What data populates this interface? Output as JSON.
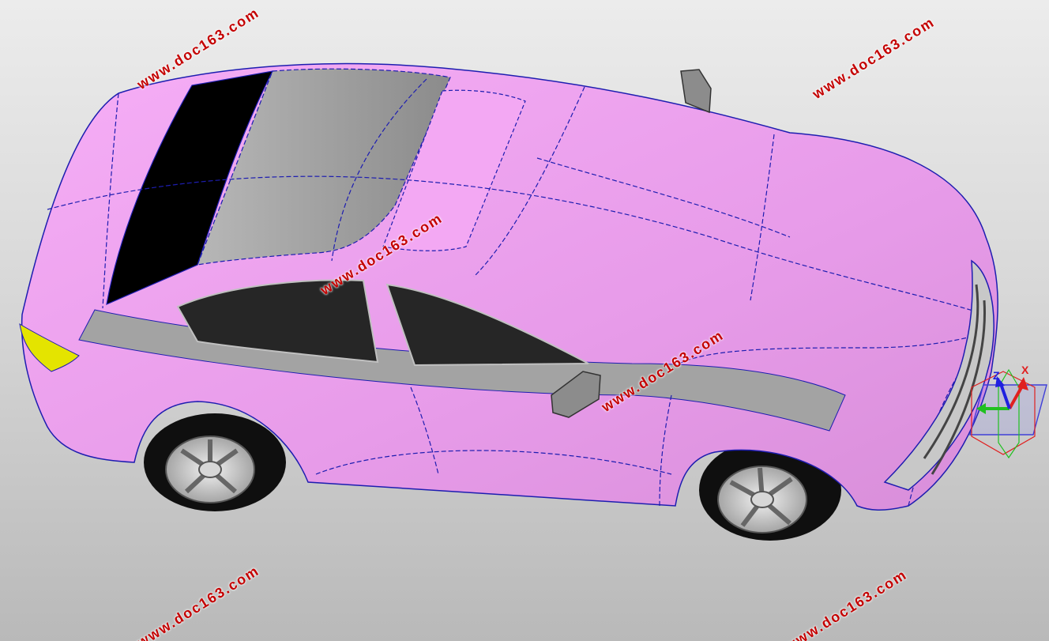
{
  "viewport": {
    "model_type": "car-surface-model",
    "body_color": "#f0a0f0",
    "trim_color": "#a3a3a3",
    "glass_color": "#1e1e1e",
    "edge_color": "#1d1db0"
  },
  "watermarks": [
    "www.doc163.com",
    "www.doc163.com",
    "www.doc163.com",
    "www.doc163.com",
    "www.doc163.com",
    "www.doc163.com"
  ],
  "triad": {
    "x_label": "X",
    "z_label": "Z",
    "x_color": "#e02020",
    "y_color": "#20c020",
    "z_color": "#2020e0"
  }
}
